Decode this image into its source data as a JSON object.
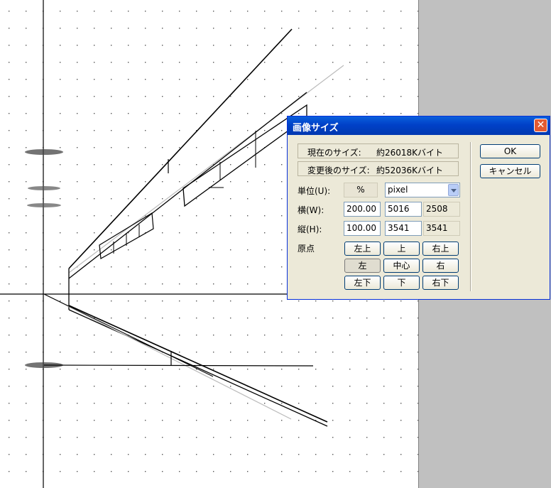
{
  "dialog": {
    "title": "画像サイズ",
    "close_glyph": "✕",
    "current_size": {
      "label": "現在のサイズ:",
      "value": "約26018Kバイト"
    },
    "new_size": {
      "label": "変更後のサイズ:",
      "value": "約52036Kバイト"
    },
    "unit": {
      "label": "単位(U):",
      "percent_symbol": "%",
      "selected": "pixel"
    },
    "width": {
      "label": "横(W):",
      "percent": "200.00",
      "value": "5016",
      "original": "2508"
    },
    "height": {
      "label": "縦(H):",
      "percent": "100.00",
      "value": "3541",
      "original": "3541"
    },
    "origin": {
      "label": "原点",
      "buttons": [
        "左上",
        "上",
        "右上",
        "左",
        "中心",
        "右",
        "左下",
        "下",
        "右下"
      ],
      "selected_index": 3
    },
    "ok_label": "OK",
    "cancel_label": "キャンセル"
  },
  "colors": {
    "title_bar": "#0a5fdc",
    "dialog_bg": "#ece9d8",
    "canvas_bg": "#ffffff",
    "workspace_bg": "#c0c0c0"
  }
}
